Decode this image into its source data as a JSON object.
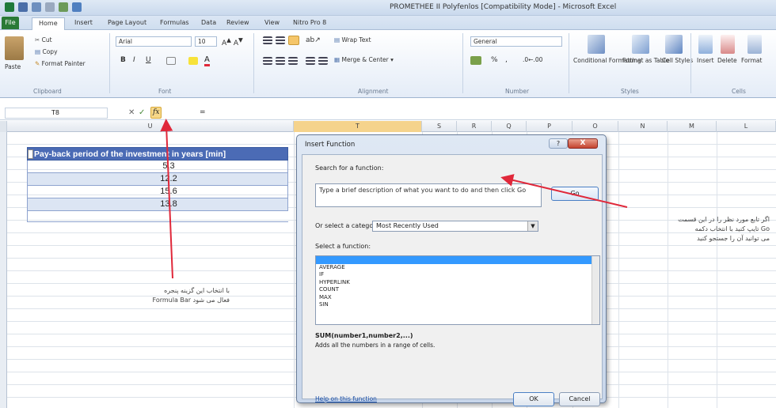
{
  "window": {
    "title": "PROMETHEE II Polyfenlos [Compatibility Mode] - Microsoft Excel"
  },
  "tabs": {
    "file": "File",
    "items": [
      "Home",
      "Insert",
      "Page Layout",
      "Formulas",
      "Data",
      "Review",
      "View",
      "Nitro Pro 8"
    ],
    "active": "Home"
  },
  "ribbon": {
    "clipboard": {
      "cut": "Cut",
      "copy": "Copy",
      "paste": "Paste",
      "format_painter": "Format Painter",
      "label": "Clipboard"
    },
    "font": {
      "name": "Arial",
      "size": "10",
      "label": "Font"
    },
    "alignment": {
      "wrap_text": "Wrap Text",
      "merge_center": "Merge & Center",
      "label": "Alignment"
    },
    "number": {
      "format": "General",
      "label": "Number"
    },
    "styles": {
      "conditional": "Conditional Formatting",
      "format_table": "Format as Table",
      "cell_styles": "Cell Styles",
      "label": "Styles"
    },
    "cells": {
      "insert": "Insert",
      "delete": "Delete",
      "format": "Format",
      "label": "Cells"
    }
  },
  "formula_bar": {
    "name_box": "T8",
    "cancel": "✕",
    "enter": "✓",
    "fx": "fx",
    "value": "="
  },
  "columns": [
    {
      "label": "U",
      "selected": false
    },
    {
      "label": "T",
      "selected": true
    },
    {
      "label": "S",
      "selected": false
    },
    {
      "label": "R",
      "selected": false
    },
    {
      "label": "Q",
      "selected": false
    },
    {
      "label": "P",
      "selected": false
    },
    {
      "label": "O",
      "selected": false
    },
    {
      "label": "N",
      "selected": false
    },
    {
      "label": "M",
      "selected": false
    },
    {
      "label": "L",
      "selected": false
    }
  ],
  "table": {
    "header": "Pay-back period of the investment in years [min]",
    "values": [
      "5.3",
      "12.2",
      "15.6",
      "13.8"
    ]
  },
  "annotations": {
    "formula_bar_note": [
      "با انتخاب این گزینه پنجره",
      "Formula Bar فعال می شود"
    ],
    "dialog_note": [
      "اگر تابع مورد نظر را در این قسمت",
      "تایپ کنید با انتخاب دکمه Go",
      "می توانید آن را جستجو کنید"
    ]
  },
  "dialog": {
    "title": "Insert Function",
    "help": "?",
    "close": "X",
    "search_label": "Search for a function:",
    "search_text": "Type a brief description of what you want to do and then click Go",
    "go": "Go",
    "category_label": "Or select a category:",
    "category_value": "Most Recently Used",
    "select_label": "Select a function:",
    "functions": [
      "SUM",
      "AVERAGE",
      "IF",
      "HYPERLINK",
      "COUNT",
      "MAX",
      "SIN"
    ],
    "selected_function": "SUM",
    "signature": "SUM(number1,number2,...)",
    "description": "Adds all the numbers in a range of cells.",
    "help_link": "Help on this function",
    "ok": "OK",
    "cancel": "Cancel"
  },
  "colors": {
    "accent": "#4b6bb5",
    "arrow": "#e0283a",
    "file_tab": "#2a7a36",
    "selected_column": "#f5d38c"
  }
}
